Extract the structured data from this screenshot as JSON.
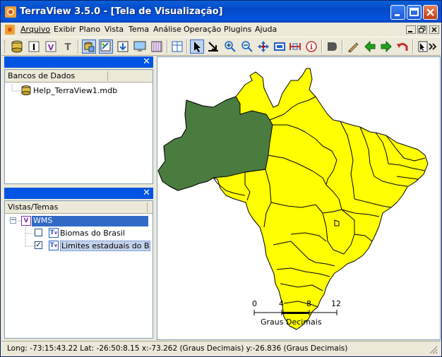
{
  "window": {
    "title": "TerraView 3.5.0 - [Tela de Visualização]"
  },
  "menu": {
    "items": [
      "Arquivo",
      "Exibir",
      "Plano",
      "Vista",
      "Tema",
      "Análise",
      "Operação",
      "Plugins",
      "Ajuda"
    ]
  },
  "toolbar": {
    "icons": [
      "database-icon",
      "info-text-icon",
      "view-icon",
      "text-tool-icon",
      "db-open-icon",
      "theme-edit-icon",
      "import-icon",
      "display-icon",
      "table-icon",
      "grid-icon",
      "pointer-icon",
      "select-arrow-icon",
      "zoom-in-icon",
      "zoom-out-icon",
      "pan-icon",
      "fit-area-icon",
      "measure-icon",
      "info-icon",
      "shape-icon",
      "pencil-icon",
      "back-arrow-icon",
      "forward-arrow-icon",
      "undo-icon",
      "cursor-flag-icon",
      "more-icon"
    ]
  },
  "databases_panel": {
    "header": "Bancos de Dados",
    "items": [
      "Help_TerraView1.mdb"
    ]
  },
  "views_panel": {
    "header": "Vistas/Temas",
    "view": "WMS",
    "themes": [
      {
        "label": "Biomas do Brasil",
        "checked": false
      },
      {
        "label": "Limites estaduais do Brasil",
        "checked": true
      }
    ]
  },
  "scalebar": {
    "ticks": [
      "0",
      "4",
      "8",
      "12"
    ],
    "label": "Graus Decimais"
  },
  "status": {
    "text": "Long: -73:15:43.22 Lat: -26:50:8.15  x:-73.262 (Graus Decimais)  y:-26.836 (Graus Decimais)"
  },
  "colors": {
    "state_fill": "#ffff00",
    "highlight_fill": "#4a7c3f",
    "title_bar": "#0054e3",
    "selection": "#316ac5"
  }
}
